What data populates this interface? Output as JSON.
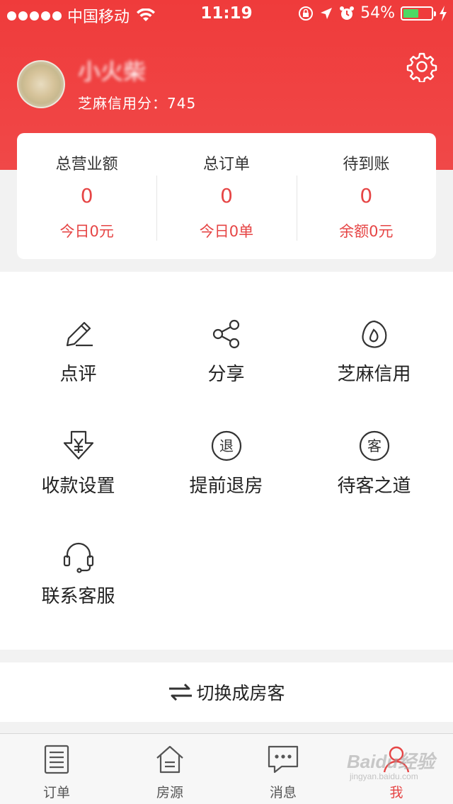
{
  "status_bar": {
    "carrier": "中国移动",
    "time": "11:19",
    "battery_percent": "54%",
    "battery_level": 0.54
  },
  "profile": {
    "username": "小火柴",
    "credit_label": "芝麻信用分：745"
  },
  "stats": [
    {
      "title": "总营业额",
      "value": "0",
      "sub": "今日0元"
    },
    {
      "title": "总订单",
      "value": "0",
      "sub": "今日0单"
    },
    {
      "title": "待到账",
      "value": "0",
      "sub": "余额0元"
    }
  ],
  "menu": [
    {
      "label": "点评",
      "icon": "pen-icon"
    },
    {
      "label": "分享",
      "icon": "share-icon"
    },
    {
      "label": "芝麻信用",
      "icon": "sesame-credit-icon"
    },
    {
      "label": "收款设置",
      "icon": "payment-settings-icon"
    },
    {
      "label": "提前退房",
      "icon": "early-checkout-icon",
      "glyph": "退"
    },
    {
      "label": "待客之道",
      "icon": "hospitality-icon",
      "glyph": "客"
    },
    {
      "label": "联系客服",
      "icon": "headset-icon"
    }
  ],
  "switch_bar": {
    "label": "切换成房客",
    "icon": "swap-arrows-icon"
  },
  "tabs": [
    {
      "label": "订单",
      "icon": "order-list-icon"
    },
    {
      "label": "房源",
      "icon": "house-icon"
    },
    {
      "label": "消息",
      "icon": "message-icon"
    },
    {
      "label": "我",
      "icon": "person-icon",
      "active": true
    }
  ],
  "watermark": {
    "text": "Baidu经验",
    "sub": "jingyan.baidu.com"
  },
  "colors": {
    "accent": "#e64545",
    "header": "#ef3b3b"
  }
}
